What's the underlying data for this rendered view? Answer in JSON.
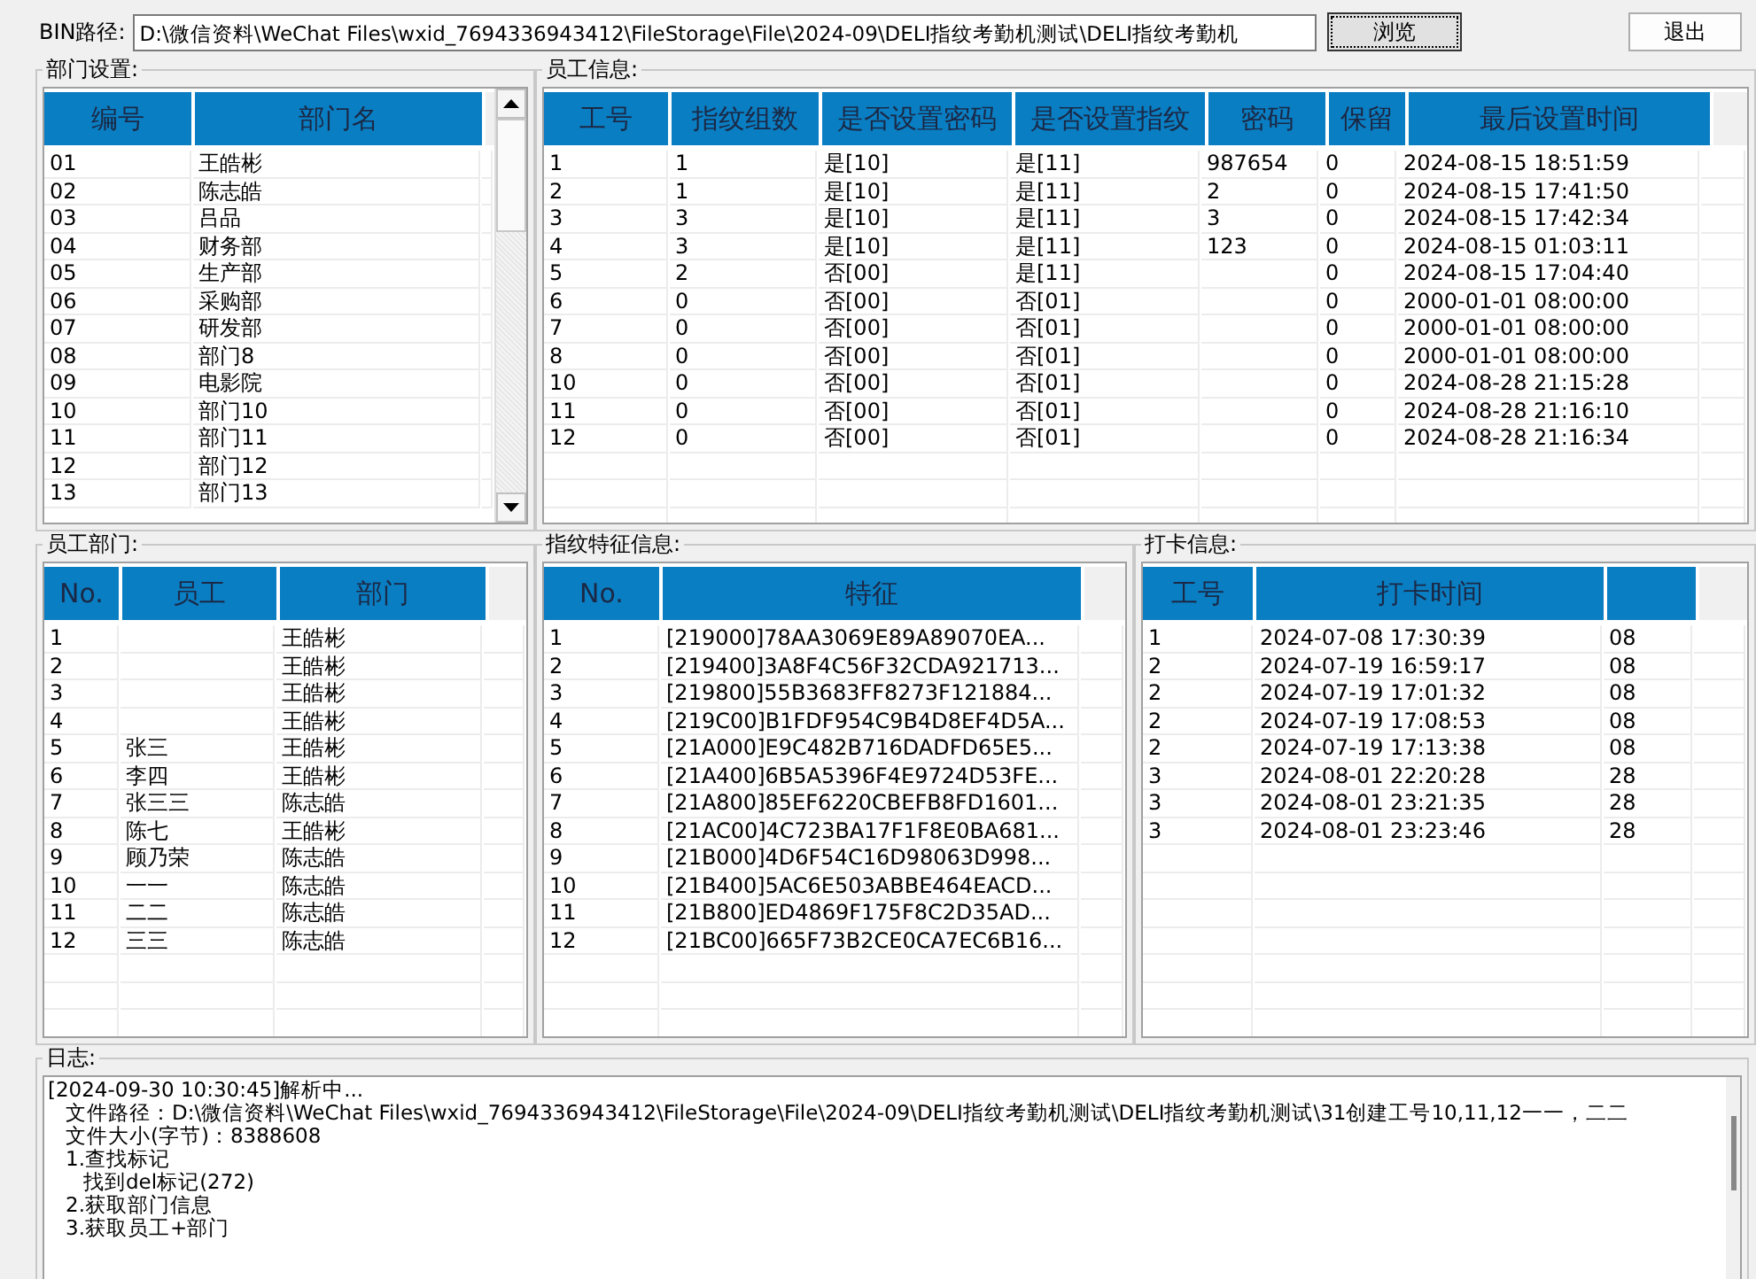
{
  "path_bar": {
    "label": "BIN路径:",
    "value": "D:\\微信资料\\WeChat Files\\wxid_7694336943412\\FileStorage\\File\\2024-09\\DELI指纹考勤机测试\\DELI指纹考勤机",
    "browse_button": "浏览",
    "exit_button": "退出"
  },
  "panels": [
    {
      "kind": "table",
      "title": "部门设置:",
      "columns": [
        "编号",
        "部门名"
      ],
      "scrollbar": true,
      "rows": [
        [
          "01",
          "王皓彬"
        ],
        [
          "02",
          "陈志皓"
        ],
        [
          "03",
          "吕品"
        ],
        [
          "04",
          "财务部"
        ],
        [
          "05",
          "生产部"
        ],
        [
          "06",
          "采购部"
        ],
        [
          "07",
          "研发部"
        ],
        [
          "08",
          "部门8"
        ],
        [
          "09",
          "电影院"
        ],
        [
          "10",
          "部门10"
        ],
        [
          "11",
          "部门11"
        ],
        [
          "12",
          "部门12"
        ],
        [
          "13",
          "部门13"
        ]
      ]
    },
    {
      "kind": "table",
      "title": "员工信息:",
      "columns": [
        "工号",
        "指纹组数",
        "是否设置密码",
        "是否设置指纹",
        "密码",
        "保留",
        "最后设置时间"
      ],
      "scrollbar": false,
      "rows": [
        [
          "1",
          "1",
          "是[10]",
          "是[11]",
          "987654",
          "0",
          "2024-08-15 18:51:59"
        ],
        [
          "2",
          "1",
          "是[10]",
          "是[11]",
          "2",
          "0",
          "2024-08-15 17:41:50"
        ],
        [
          "3",
          "3",
          "是[10]",
          "是[11]",
          "3",
          "0",
          "2024-08-15 17:42:34"
        ],
        [
          "4",
          "3",
          "是[10]",
          "是[11]",
          "123",
          "0",
          "2024-08-15 01:03:11"
        ],
        [
          "5",
          "2",
          "否[00]",
          "是[11]",
          null,
          "0",
          "2024-08-15 17:04:40"
        ],
        [
          "6",
          "0",
          "否[00]",
          "否[01]",
          null,
          "0",
          "2000-01-01 08:00:00"
        ],
        [
          "7",
          "0",
          "否[00]",
          "否[01]",
          null,
          "0",
          "2000-01-01 08:00:00"
        ],
        [
          "8",
          "0",
          "否[00]",
          "否[01]",
          null,
          "0",
          "2000-01-01 08:00:00"
        ],
        [
          "10",
          "0",
          "否[00]",
          "否[01]",
          null,
          "0",
          "2024-08-28 21:15:28"
        ],
        [
          "11",
          "0",
          "否[00]",
          "否[01]",
          null,
          "0",
          "2024-08-28 21:16:10"
        ],
        [
          "12",
          "0",
          "否[00]",
          "否[01]",
          null,
          "0",
          "2024-08-28 21:16:34"
        ]
      ]
    },
    {
      "kind": "table",
      "title": "员工部门:",
      "columns": [
        "No.",
        "员工",
        "部门"
      ],
      "scrollbar": false,
      "rows": [
        [
          "1",
          null,
          "王皓彬"
        ],
        [
          "2",
          null,
          "王皓彬"
        ],
        [
          "3",
          null,
          "王皓彬"
        ],
        [
          "4",
          null,
          "王皓彬"
        ],
        [
          "5",
          "张三",
          "王皓彬"
        ],
        [
          "6",
          "李四",
          "王皓彬"
        ],
        [
          "7",
          "张三三",
          "陈志皓"
        ],
        [
          "8",
          "陈七",
          "王皓彬"
        ],
        [
          "9",
          "顾乃荣",
          "陈志皓"
        ],
        [
          "10",
          "一一",
          "陈志皓"
        ],
        [
          "11",
          "二二",
          "陈志皓"
        ],
        [
          "12",
          "三三",
          "陈志皓"
        ]
      ]
    },
    {
      "kind": "table",
      "title": "指纹特征信息:",
      "columns": [
        "No.",
        "特征"
      ],
      "scrollbar": false,
      "rows": [
        [
          "1",
          "[219000]78AA3069E89A89070EA..."
        ],
        [
          "2",
          "[219400]3A8F4C56F32CDA921713..."
        ],
        [
          "3",
          "[219800]55B3683FF8273F121884..."
        ],
        [
          "4",
          "[219C00]B1FDF954C9B4D8EF4D5A..."
        ],
        [
          "5",
          "[21A000]E9C482B716DADFD65E5..."
        ],
        [
          "6",
          "[21A400]6B5A5396F4E9724D53FE..."
        ],
        [
          "7",
          "[21A800]85EF6220CBEFB8FD1601..."
        ],
        [
          "8",
          "[21AC00]4C723BA17F1F8E0BA681..."
        ],
        [
          "9",
          "[21B000]4D6F54C16D98063D998..."
        ],
        [
          "10",
          "[21B400]5AC6E503ABBE464EACD..."
        ],
        [
          "11",
          "[21B800]ED4869F175F8C2D35AD..."
        ],
        [
          "12",
          "[21BC00]665F73B2CE0CA7EC6B16..."
        ]
      ]
    },
    {
      "kind": "table",
      "title": "打卡信息:",
      "columns": [
        "工号",
        "打卡时间"
      ],
      "scrollbar": false,
      "rows": [
        [
          "1",
          "2024-07-08 17:30:39",
          "08"
        ],
        [
          "2",
          "2024-07-19 16:59:17",
          "08"
        ],
        [
          "2",
          "2024-07-19 17:01:32",
          "08"
        ],
        [
          "2",
          "2024-07-19 17:08:53",
          "08"
        ],
        [
          "2",
          "2024-07-19 17:13:38",
          "08"
        ],
        [
          "3",
          "2024-08-01 22:20:28",
          "28"
        ],
        [
          "3",
          "2024-08-01 23:21:35",
          "28"
        ],
        [
          "3",
          "2024-08-01 23:23:46",
          "28"
        ]
      ]
    }
  ],
  "log": {
    "title": "日志:",
    "lines": [
      {
        "text": "[2024-09-30 10:30:45]解析中...",
        "children": [
          {
            "text": "文件路径：D:\\微信资料\\WeChat Files\\wxid_7694336943412\\FileStorage\\File\\2024-09\\DELI指纹考勤机测试\\DELI指纹考勤机测试\\31创建工号10,11,12一一，二二"
          },
          {
            "text": "文件大小(字节)：8388608"
          },
          {
            "text": "1.查找标记",
            "children": [
              {
                "text": "找到del标记(272)"
              }
            ]
          },
          {
            "text": "2.获取部门信息"
          },
          {
            "text": "3.获取员工+部门"
          }
        ]
      }
    ]
  }
}
